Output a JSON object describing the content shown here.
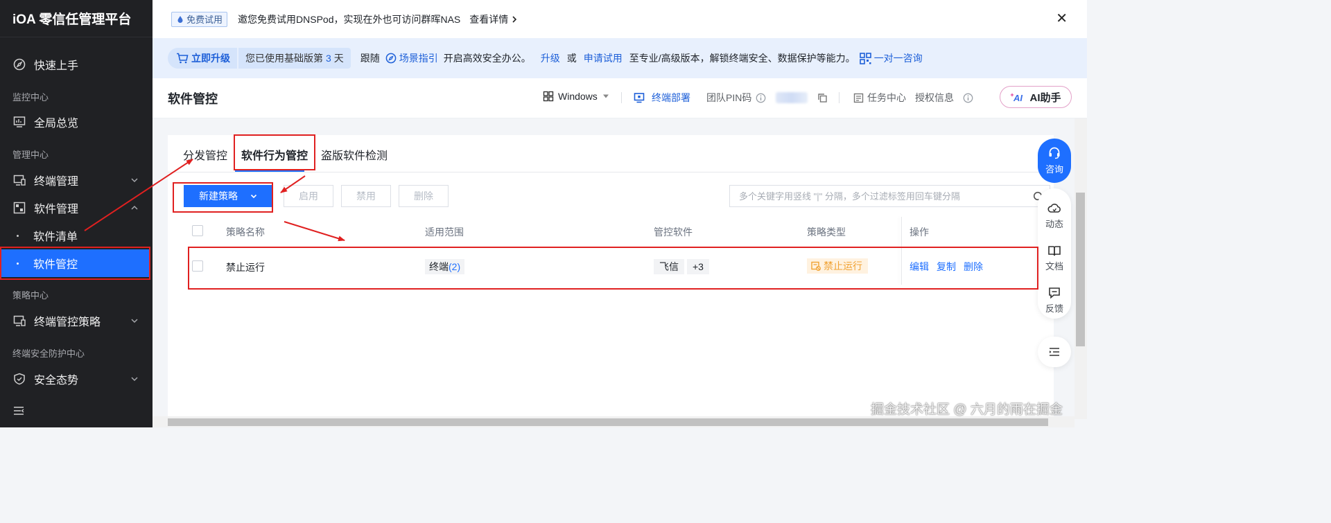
{
  "sidebar": {
    "brand": "iOA 零信任管理平台",
    "quick_start": "快速上手",
    "group_monitor": "监控中心",
    "overview": "全局总览",
    "group_manage": "管理中心",
    "endpoint_mgmt": "终端管理",
    "software_mgmt": "软件管理",
    "software_list": "软件清单",
    "software_control": "软件管控",
    "group_policy": "策略中心",
    "endpoint_policy": "终端管控策略",
    "group_security": "终端安全防护中心",
    "security_posture": "安全态势"
  },
  "banner_top": {
    "tag": "免费试用",
    "message": "邀您免费试用DNSPod，实现在外也可访问群晖NAS",
    "detail": "查看详情"
  },
  "banner_upgrade": {
    "upgrade_now": "立即升级",
    "base_prefix": "您已使用基础版第",
    "base_days": "3",
    "base_suffix": "天",
    "follow": "跟随",
    "scene_guide": "场景指引",
    "start_text": "开启高效安全办公。",
    "upgrade": "升级",
    "or": "或",
    "apply_trial": "申请试用",
    "tail_text": "至专业/高级版本，解锁终端安全、数据保护等能力。",
    "consult": "一对一咨询"
  },
  "header": {
    "title": "软件管控",
    "os": "Windows",
    "deploy": "终端部署",
    "team_pin": "团队PIN码",
    "task_center": "任务中心",
    "license_info": "授权信息",
    "ai_assistant": "AI助手"
  },
  "tabs": [
    "分发管控",
    "软件行为管控",
    "盗版软件检测"
  ],
  "toolbar": {
    "new_policy": "新建策略",
    "enable": "启用",
    "disable": "禁用",
    "delete": "删除",
    "search_placeholder": "多个关键字用竖线 \"|\" 分隔，多个过滤标签用回车键分隔"
  },
  "table": {
    "headers": [
      "策略名称",
      "适用范围",
      "管控软件",
      "策略类型",
      "操作"
    ],
    "rows": [
      {
        "name": "禁止运行",
        "scope_label": "终端",
        "scope_count": "(2)",
        "software": "飞信",
        "software_more": "+3",
        "type": "禁止运行",
        "actions": [
          "编辑",
          "复制",
          "删除"
        ]
      }
    ]
  },
  "float_panel": {
    "consult": "咨询",
    "dynamic": "动态",
    "docs": "文档",
    "feedback": "反馈"
  },
  "watermark": "掘金技术社区 @ 六月的雨在掘金",
  "colors": {
    "primary": "#1e6fff",
    "sidebar_bg": "#202124",
    "annotation_red": "#e02020",
    "warning": "#f0a233"
  }
}
